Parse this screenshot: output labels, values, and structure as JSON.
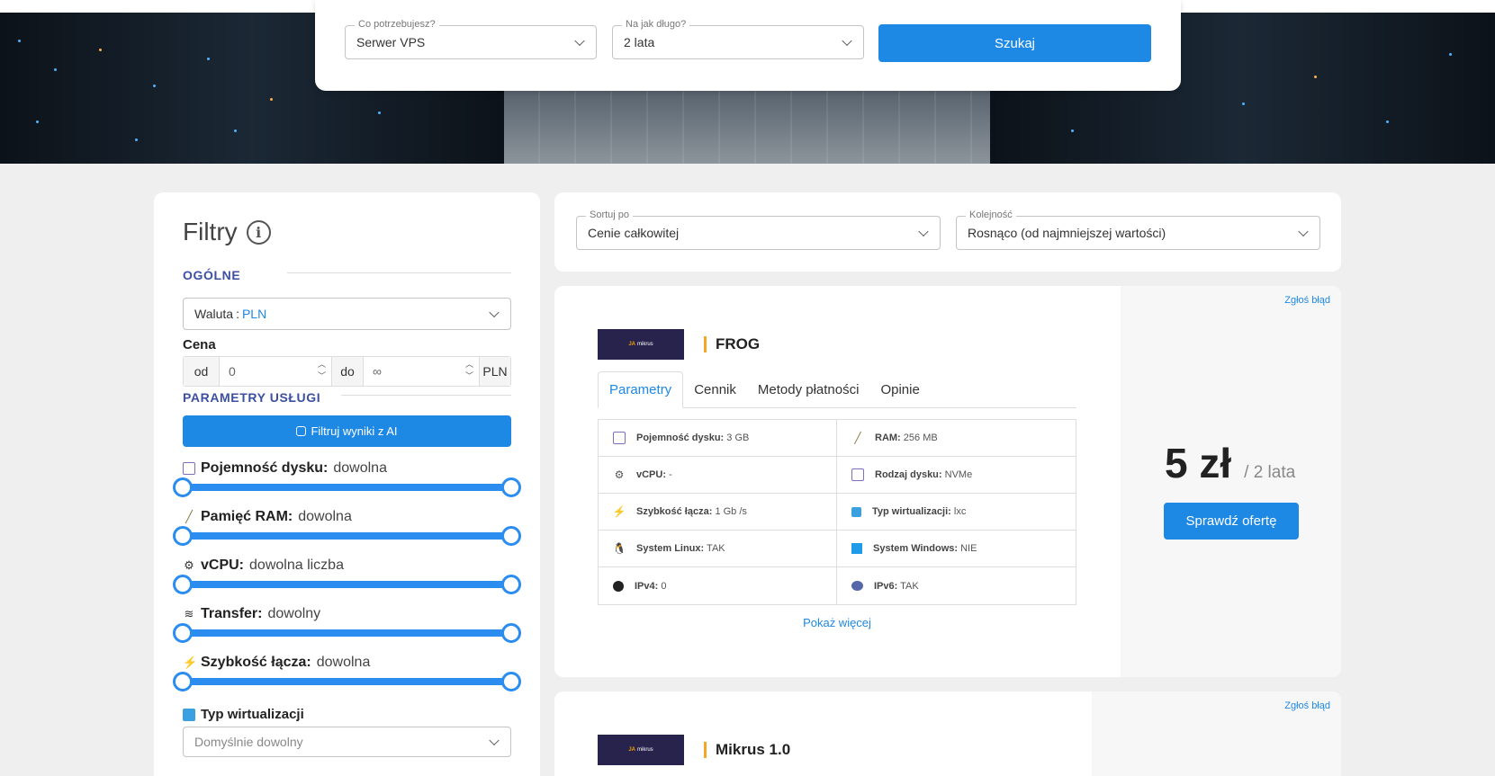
{
  "search": {
    "need_label": "Co potrzebujesz?",
    "need_value": "Serwer VPS",
    "duration_label": "Na jak długo?",
    "duration_value": "2 lata",
    "button": "Szukaj"
  },
  "filters": {
    "title": "Filtry",
    "info_glyph": "i",
    "general_heading": "OGÓLNE",
    "currency_label": "Waluta",
    "currency_value": "PLN",
    "price_label": "Cena",
    "price_from_label": "od",
    "price_from_value": "0",
    "price_to_label": "do",
    "price_to_value": "∞",
    "price_unit": "PLN",
    "params_heading": "PARAMETRY USŁUGI",
    "ai_button": "Filtruj wyniki z AI",
    "sliders": [
      {
        "label": "Pojemność dysku:",
        "value": "dowolna",
        "icon": "disk-icon"
      },
      {
        "label": "Pamięć RAM:",
        "value": "dowolna",
        "icon": "ram-icon"
      },
      {
        "label": "vCPU:",
        "value": "dowolna liczba",
        "icon": "cpu-icon"
      },
      {
        "label": "Transfer:",
        "value": "dowolny",
        "icon": "wifi-icon"
      },
      {
        "label": "Szybkość łącza:",
        "value": "dowolna",
        "icon": "cable-icon"
      }
    ],
    "virt_label": "Typ wirtualizacji",
    "virt_value": "Domyślnie dowolny"
  },
  "sort": {
    "sort_label": "Sortuj po",
    "sort_value": "Cenie całkowitej",
    "order_label": "Kolejność",
    "order_value": "Rosnąco (od najmniejszej wartości)"
  },
  "offers": [
    {
      "report": "Zgłoś błąd",
      "logo_mark": "JA",
      "logo_text": "mikrus",
      "name": "FROG",
      "tabs": [
        "Parametry",
        "Cennik",
        "Metody płatności",
        "Opinie"
      ],
      "params": [
        {
          "label": "Pojemność dysku:",
          "value": "3 GB",
          "icon": "disk-icon"
        },
        {
          "label": "RAM:",
          "value": "256 MB",
          "icon": "ram-icon"
        },
        {
          "label": "vCPU:",
          "value": "-",
          "icon": "cpu-icon"
        },
        {
          "label": "Rodzaj dysku:",
          "value": "NVMe",
          "icon": "disk-type-icon"
        },
        {
          "label": "Szybkość łącza:",
          "value": "1 Gb /s",
          "icon": "cable-icon"
        },
        {
          "label": "Typ wirtualizacji:",
          "value": "lxc",
          "icon": "cube-icon"
        },
        {
          "label": "System Linux:",
          "value": "TAK",
          "icon": "linux-icon"
        },
        {
          "label": "System Windows:",
          "value": "NIE",
          "icon": "windows-icon"
        },
        {
          "label": "IPv4:",
          "value": "0",
          "icon": "ipv4-icon"
        },
        {
          "label": "IPv6:",
          "value": "TAK",
          "icon": "ipv6-icon"
        }
      ],
      "more": "Pokaż więcej",
      "price": "5 zł",
      "period": "/ 2 lata",
      "cta": "Sprawdź ofertę"
    },
    {
      "report": "Zgłoś błąd",
      "logo_mark": "JA",
      "logo_text": "mikrus",
      "name": "Mikrus 1.0"
    }
  ],
  "colors": {
    "accent": "#1e88e5",
    "heading": "#3c4fa3",
    "name_bar": "#f5a623"
  }
}
